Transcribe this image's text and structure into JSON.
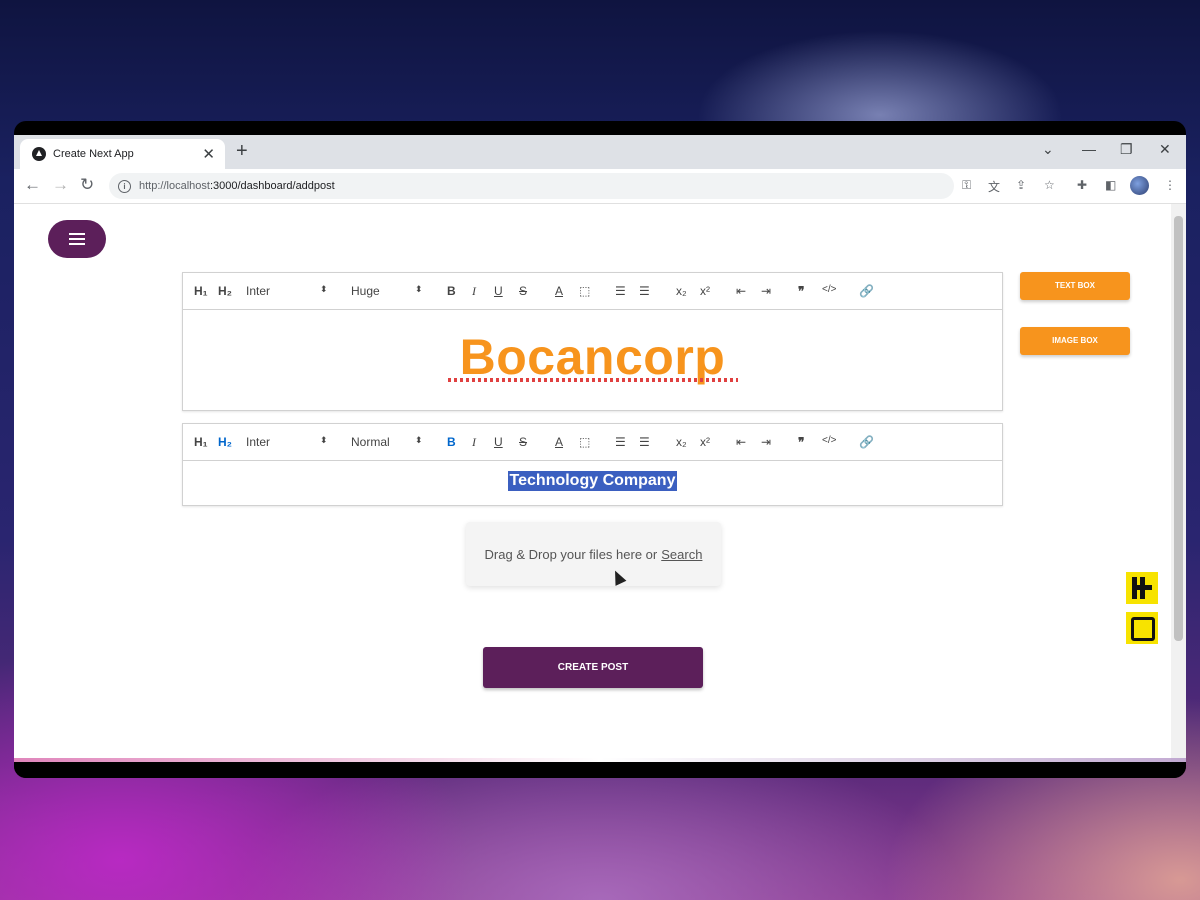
{
  "browser": {
    "tab_title": "Create Next App",
    "url_host": "http://localhost",
    "url_path": ":3000/dashboard/addpost"
  },
  "editor1": {
    "h1": "H₁",
    "h2": "H₂",
    "font": "Inter",
    "size": "Huge",
    "content": "Bocancorp"
  },
  "editor2": {
    "h1": "H₁",
    "h2": "H₂",
    "font": "Inter",
    "size": "Normal",
    "content": "Technology Company"
  },
  "sidebar": {
    "text_box": "TEXT BOX",
    "image_box": "IMAGE BOX"
  },
  "dropzone": {
    "text": "Drag & Drop your files here or",
    "link": "Search"
  },
  "create_post": "CREATE POST",
  "colors": {
    "accent_orange": "#f7941d",
    "brand_purple": "#5c1f5a",
    "selection_blue": "#3b5fc0"
  }
}
